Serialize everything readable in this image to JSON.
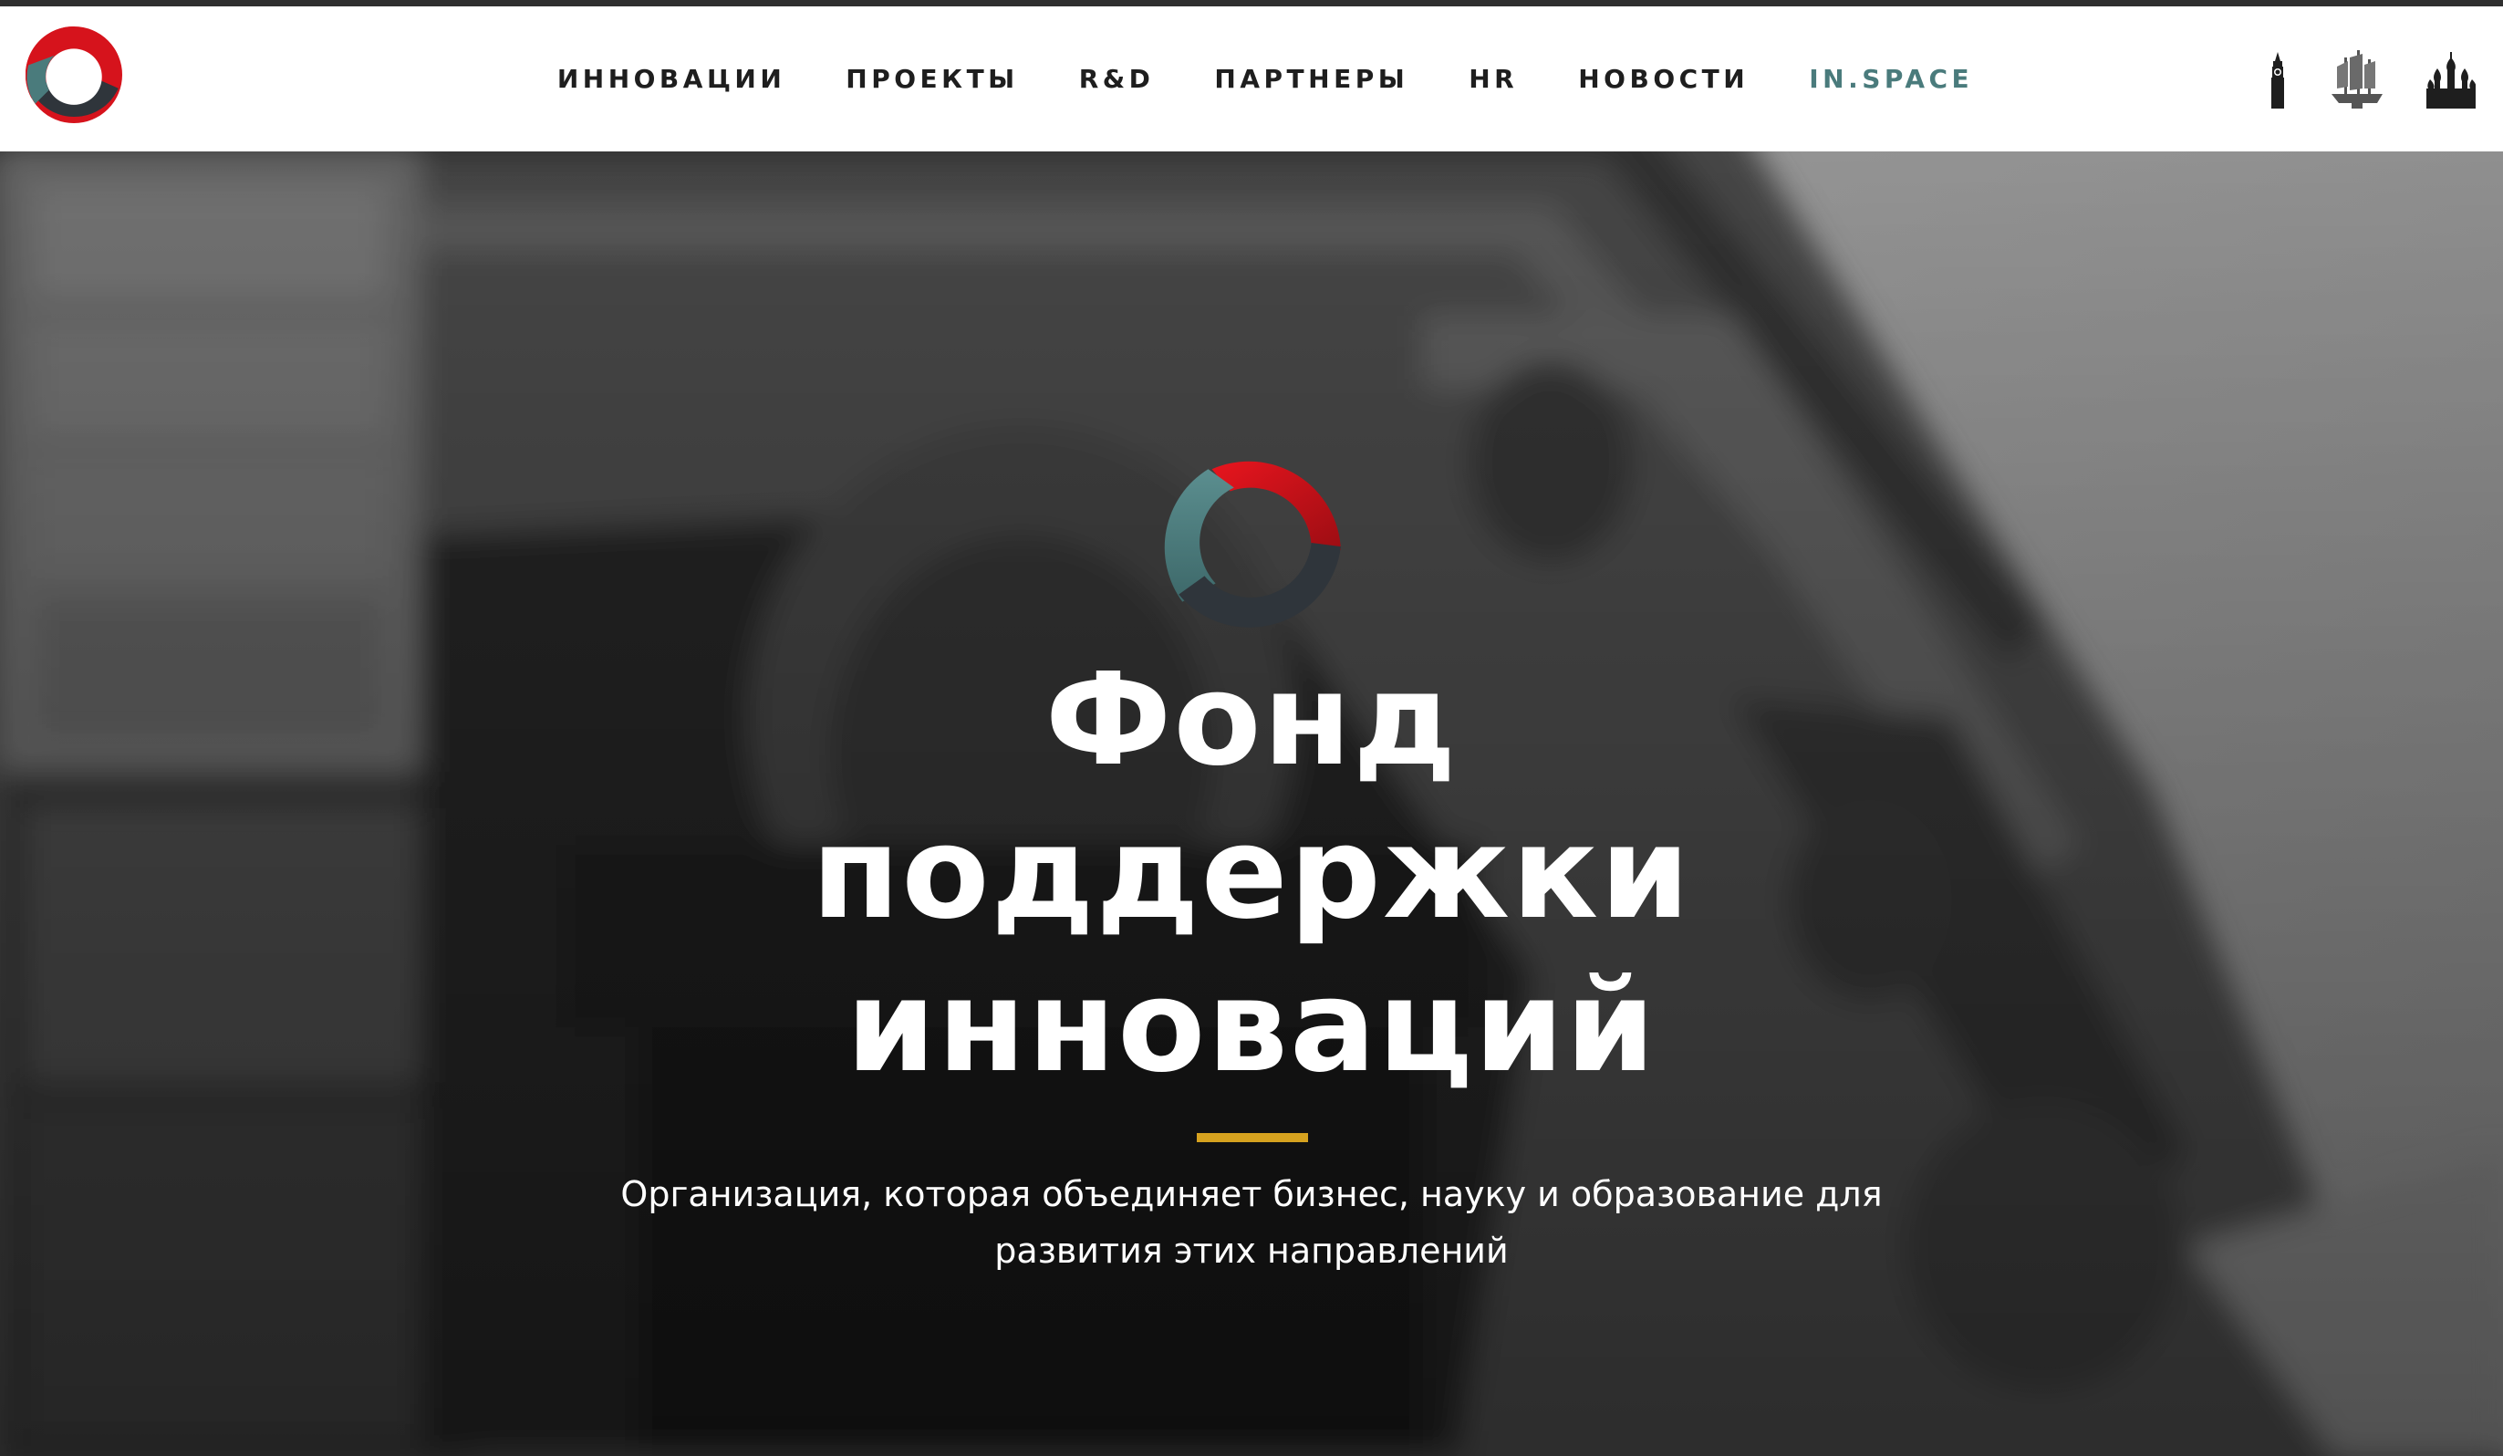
{
  "header": {
    "logo_name": "fund-logo",
    "nav": [
      {
        "label": "ИННОВАЦИИ"
      },
      {
        "label": "ПРОЕКТЫ"
      },
      {
        "label": "R&D"
      },
      {
        "label": "ПАРТНЕРЫ"
      },
      {
        "label": "HR"
      },
      {
        "label": "НОВОСТИ"
      },
      {
        "label": "IN.SPACE"
      }
    ],
    "city_icons": [
      "big-ben-icon",
      "ship-monument-icon",
      "kremlin-icon"
    ]
  },
  "hero": {
    "title_lines": [
      "Фонд",
      "поддержки",
      "инноваций"
    ],
    "subtitle_lines": [
      "Организация, которая объединяет бизнес, науку и образование для",
      "развития этих направлений"
    ],
    "accent_color": "#d6a21f"
  },
  "colors": {
    "brand_red": "#d6131c",
    "brand_teal": "#4a7b7c",
    "brand_dark": "#2f353b",
    "nav_text": "#1e1e1e"
  }
}
